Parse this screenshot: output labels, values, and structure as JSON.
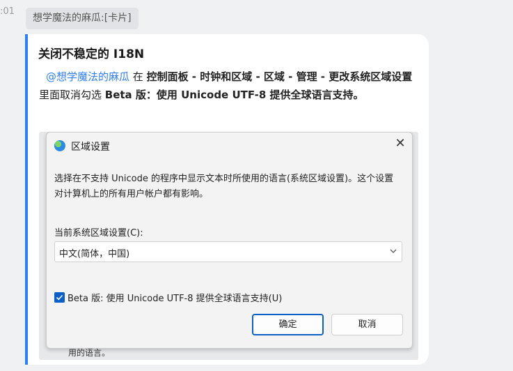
{
  "timestamp_partial": ":01",
  "sender_chip": "想学魔法的麻瓜:[卡片]",
  "card": {
    "title": "关闭不稳定的 I18N",
    "mention": "@想学魔法的麻瓜",
    "text_1": " 在 ",
    "path": "控制面板 - 时钟和区域 - 区域 - 管理 - 更改系统区域设置",
    "text_2": " 里面取消勾选 ",
    "option_name": "Beta 版：使用 Unicode UTF-8 提供全球语言支持。"
  },
  "dialog": {
    "title": "区域设置",
    "close_icon": "close-icon",
    "description": "选择在不支持 Unicode 的程序中显示文本时所使用的语言(系统区域设置)。这个设置对计算机上的所有用户帐户都有影响。",
    "locale_label": "当前系统区域设置(C):",
    "locale_value": "中文(简体，中国)",
    "checkbox_label": "Beta 版: 使用 Unicode UTF-8 提供全球语言支持(U)",
    "checkbox_checked": true,
    "ok_label": "确定",
    "cancel_label": "取消",
    "under_text": "用的语言。"
  },
  "colors": {
    "accent": "#2f7ff0",
    "checkbox": "#0b5fc6"
  }
}
